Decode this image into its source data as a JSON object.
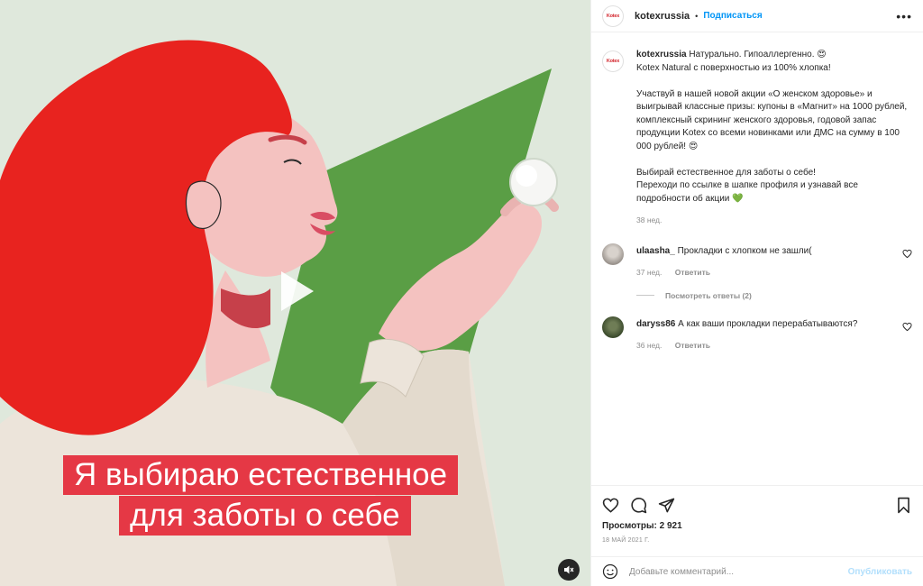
{
  "media": {
    "caption_line1": "Я выбираю естественное",
    "caption_line2": "для заботы о себе",
    "colors": {
      "background": "#dfe8dc",
      "triangle": "#5a9e45",
      "hair": "#e8231f",
      "caption_bg": "#e53845"
    }
  },
  "header": {
    "brand_logo": "Kotex",
    "username": "kotexrussia",
    "separator": "•",
    "follow_label": "Подписаться",
    "more_icon": "more-horizontal-icon"
  },
  "post": {
    "username": "kotexrussia",
    "line1": "Натурально. Гипоаллергенно. 😍",
    "line2": "Kotex Natural с поверхностью из 100% хлопка!",
    "para2": "Участвуй в нашей новой акции «О женском здоровье» и выигрывай классные призы: купоны в «Магнит» на 1000 рублей, комплексный скрининг женского здоровья, годовой запас продукции Kotex со всеми новинками или ДМС на сумму в 100 000 рублей! 😍",
    "para3_line1": "Выбирай естественное для заботы о себе!",
    "para3_line2": "Переходи по ссылке в шапке профиля и узнавай все подробности об акции 💚",
    "time": "38 нед."
  },
  "comments": [
    {
      "username": "ulaasha_",
      "text": "Прокладки с хлопком не зашли(",
      "time": "37 нед.",
      "reply": "Ответить"
    },
    {
      "username": "daryss86",
      "text": "А как ваши прокладки перерабатываются?",
      "time": "36 нед.",
      "reply": "Ответить"
    }
  ],
  "view_replies": "Посмотреть ответы (2)",
  "stats": {
    "views": "Просмотры: 2 921",
    "date": "18 МАЙ 2021 Г."
  },
  "comment_box": {
    "placeholder": "Добавьте комментарий...",
    "publish_label": "Опубликовать"
  }
}
